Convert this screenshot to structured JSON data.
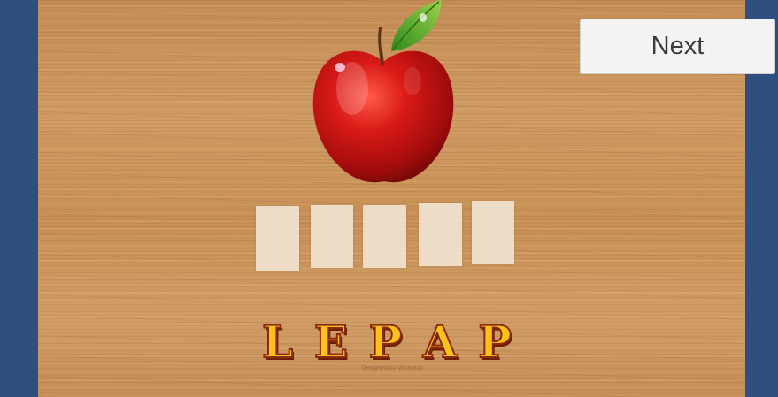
{
  "header": {
    "next_label": "Next"
  },
  "puzzle": {
    "picture": "apple",
    "slot_count": 5,
    "scrambled_letters": [
      "L",
      "E",
      "P",
      "A",
      "P"
    ]
  },
  "watermark": {
    "text": "Designed by Vecteezy"
  },
  "colors": {
    "backdrop": "#2f4f7f",
    "wood": "#c9925a",
    "letter_fill": "#ffc21a",
    "letter_outline": "#8a2a08",
    "slot": "#f1e3d0"
  }
}
